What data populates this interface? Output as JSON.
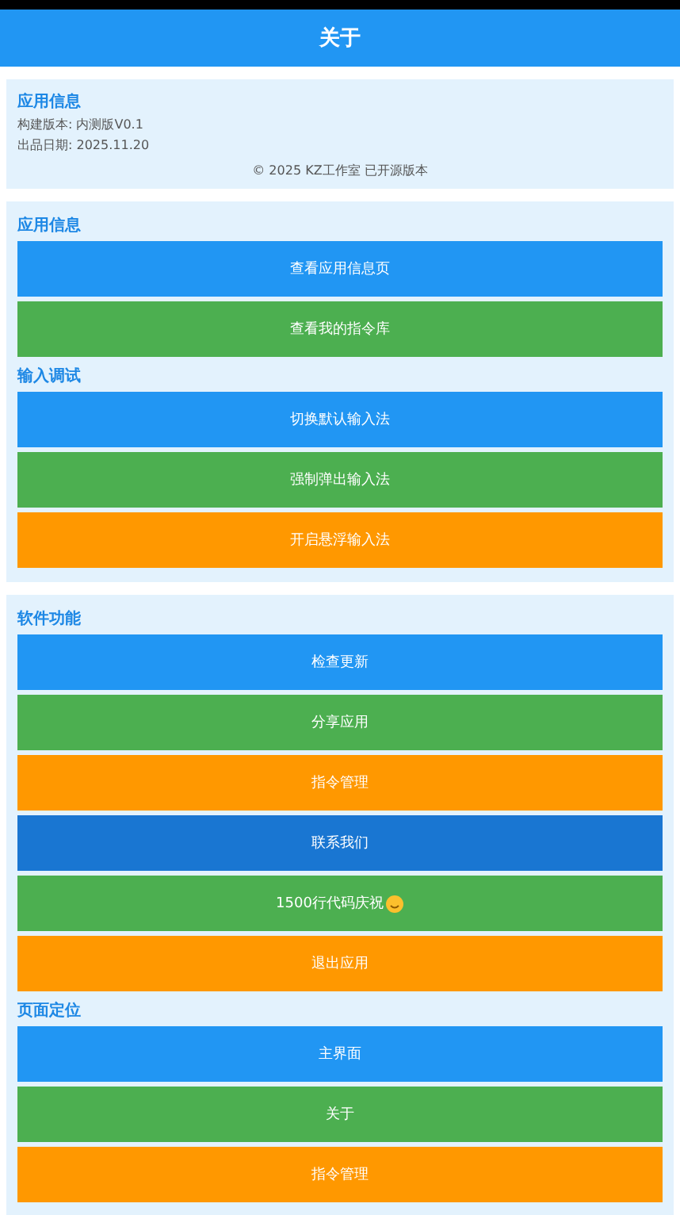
{
  "app_bar": {
    "title": "关于"
  },
  "info_card": {
    "title": "应用信息",
    "lines": [
      "构建版本: 内测版V0.1",
      "出品日期: 2025.11.20"
    ],
    "footer": "© 2025 KZ工作室 已开源版本"
  },
  "cards": [
    {
      "groups": [
        {
          "title": "应用信息",
          "buttons": [
            {
              "label": "查看应用信息页",
              "color": "#2196f3",
              "emoji": false
            },
            {
              "label": "查看我的指令库",
              "color": "#4caf50",
              "emoji": false
            }
          ]
        },
        {
          "title": "输入调试",
          "buttons": [
            {
              "label": "切换默认输入法",
              "color": "#2196f3",
              "emoji": false
            },
            {
              "label": "强制弹出输入法",
              "color": "#4caf50",
              "emoji": false
            },
            {
              "label": "开启悬浮输入法",
              "color": "#ff9800",
              "emoji": false
            }
          ]
        }
      ]
    },
    {
      "groups": [
        {
          "title": "软件功能",
          "buttons": [
            {
              "label": "检查更新",
              "color": "#2196f3",
              "emoji": false
            },
            {
              "label": "分享应用",
              "color": "#4caf50",
              "emoji": false
            },
            {
              "label": "指令管理",
              "color": "#ff9800",
              "emoji": false
            },
            {
              "label": "联系我们",
              "color": "#1976d2",
              "emoji": false
            },
            {
              "label": "1500行代码庆祝",
              "color": "#4caf50",
              "emoji": true
            },
            {
              "label": "退出应用",
              "color": "#ff9800",
              "emoji": false
            }
          ]
        },
        {
          "title": "页面定位",
          "buttons": [
            {
              "label": "主界面",
              "color": "#2196f3",
              "emoji": false
            },
            {
              "label": "关于",
              "color": "#4caf50",
              "emoji": false
            },
            {
              "label": "指令管理",
              "color": "#ff9800",
              "emoji": false
            }
          ]
        }
      ]
    }
  ]
}
